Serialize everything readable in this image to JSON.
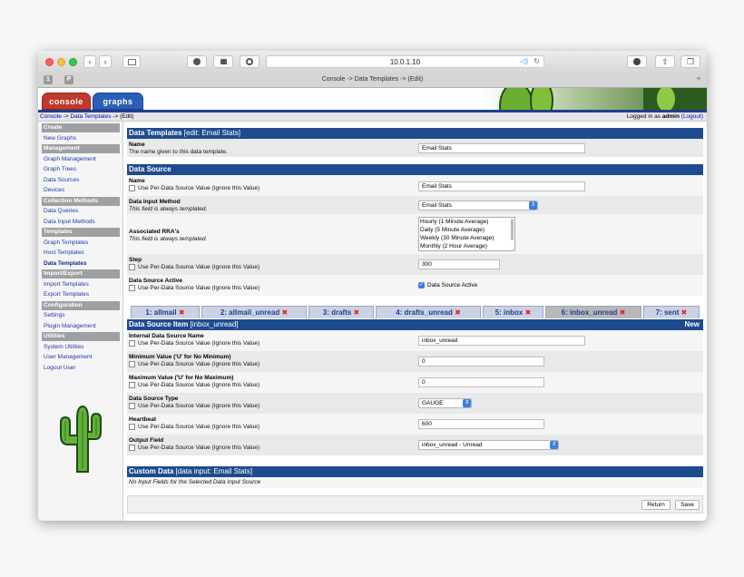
{
  "browser": {
    "url": "10.0.1.10",
    "tab_title": "Console -> Data Templates -> (Edit)",
    "pin1": "1",
    "pin2": "P"
  },
  "header": {
    "tab_console": "console",
    "tab_graphs": "graphs"
  },
  "breadcrumb": {
    "console": "Console",
    "sep1": " -> ",
    "data_templates": "Data Templates",
    "sep2": " -> ",
    "edit": "(Edit)",
    "logged_in_prefix": "Logged in as ",
    "user": "admin",
    "logout": "(Logout)"
  },
  "sidebar": [
    {
      "type": "header",
      "label": "Create"
    },
    {
      "type": "item",
      "label": "New Graphs"
    },
    {
      "type": "header",
      "label": "Management"
    },
    {
      "type": "item",
      "label": "Graph Management"
    },
    {
      "type": "item",
      "label": "Graph Trees"
    },
    {
      "type": "item",
      "label": "Data Sources"
    },
    {
      "type": "item",
      "label": "Devices"
    },
    {
      "type": "header",
      "label": "Collection Methods"
    },
    {
      "type": "item",
      "label": "Data Queries"
    },
    {
      "type": "item",
      "label": "Data Input Methods"
    },
    {
      "type": "header",
      "label": "Templates"
    },
    {
      "type": "item",
      "label": "Graph Templates"
    },
    {
      "type": "item",
      "label": "Host Templates"
    },
    {
      "type": "item",
      "label": "Data Templates",
      "active": true
    },
    {
      "type": "header",
      "label": "Import/Export"
    },
    {
      "type": "item",
      "label": "Import Templates"
    },
    {
      "type": "item",
      "label": "Export Templates"
    },
    {
      "type": "header",
      "label": "Configuration"
    },
    {
      "type": "item",
      "label": "Settings"
    },
    {
      "type": "item",
      "label": "Plugin Management"
    },
    {
      "type": "header",
      "label": "Utilities"
    },
    {
      "type": "item",
      "label": "System Utilities"
    },
    {
      "type": "item",
      "label": "User Management"
    },
    {
      "type": "item",
      "label": "Logout User"
    }
  ],
  "data_templates": {
    "title": "Data Templates",
    "subtitle": " [edit: Email Stats]",
    "name_label": "Name",
    "name_desc": "The name given to this data template.",
    "name_value": "Email Stats"
  },
  "data_source": {
    "title": "Data Source",
    "name_label": "Name",
    "name_value": "Email Stats",
    "per_ds": "Use Per-Data Source Value (Ignore this Value)",
    "input_method_label": "Data Input Method",
    "templated_note": "This field is always templated.",
    "input_method_value": "Email Stats",
    "rra_label": "Associated RRA's",
    "rra_options": [
      "Hourly (1 Minute Average)",
      "Daily (5 Minute Average)",
      "Weekly (30 Minute Average)",
      "Monthly (2 Hour Average)"
    ],
    "step_label": "Step",
    "step_value": "300",
    "active_label": "Data Source Active",
    "active_check_label": "Data Source Active"
  },
  "ds_tabs": [
    {
      "label": "1: allmail"
    },
    {
      "label": "2: allmail_unread"
    },
    {
      "label": "3: drafts"
    },
    {
      "label": "4: drafts_unread"
    },
    {
      "label": "5: inbox"
    },
    {
      "label": "6: inbox_unread",
      "active": true
    },
    {
      "label": "7: sent"
    }
  ],
  "ds_tab_close": "✖",
  "ds_item": {
    "title": "Data Source Item",
    "subtitle": " [inbox_unread]",
    "new_label": "New",
    "internal_name_label": "Internal Data Source Name",
    "internal_name_value": "inbox_unread",
    "min_label": "Minimum Value ('U' for No Minimum)",
    "min_value": "0",
    "max_label": "Maximum Value ('U' for No Maximum)",
    "max_value": "0",
    "type_label": "Data Source Type",
    "type_value": "GAUGE",
    "heartbeat_label": "Heartbeat",
    "heartbeat_value": "600",
    "output_label": "Output Field",
    "output_value": "inbox_unread - Unread"
  },
  "custom_data": {
    "title": "Custom Data",
    "subtitle": " [data input: Email Stats]",
    "note": "No Input Fields for the Selected Data Input Source"
  },
  "buttons": {
    "return": "Return",
    "save": "Save"
  },
  "colors": {
    "header_blue": "#1e4b8f",
    "console_tab": "#c0392b",
    "graphs_tab": "#2a5fb8",
    "sidebar_header": "#9ea1a3",
    "close_x": "#dd2222"
  }
}
